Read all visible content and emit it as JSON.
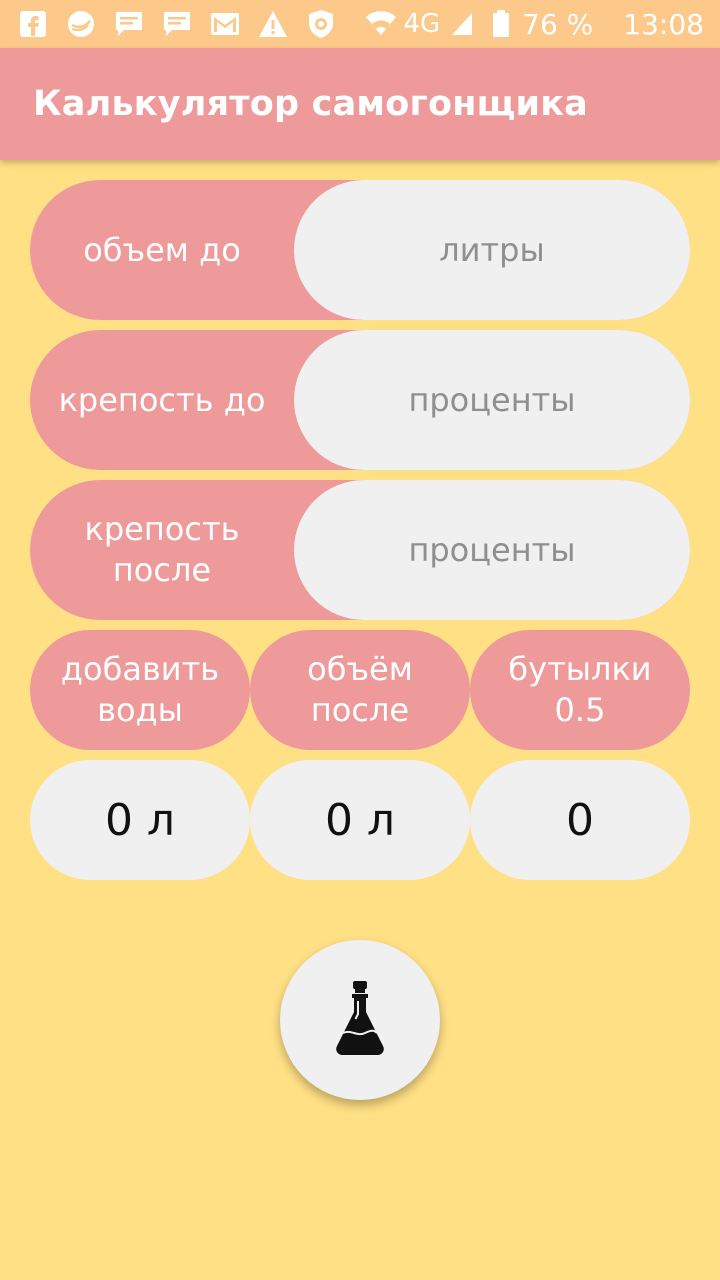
{
  "status_bar": {
    "network": "4G",
    "battery": "76 %",
    "time": "13:08"
  },
  "app_bar": {
    "title": "Калькулятор самогонщика"
  },
  "inputs": [
    {
      "label": "объем до",
      "placeholder": "литры",
      "value": ""
    },
    {
      "label": "крепость до",
      "placeholder": "проценты",
      "value": ""
    },
    {
      "label": "крепость после",
      "placeholder": "проценты",
      "value": ""
    }
  ],
  "results": {
    "headers": [
      "добавить воды",
      "объём после",
      "бутылки 0.5"
    ],
    "values": [
      "0 л",
      "0 л",
      "0"
    ]
  },
  "colors": {
    "background": "#FFE085",
    "status_bar": "#FCC98A",
    "accent": "#EE9A9A",
    "field": "#F0F0F0"
  },
  "icons": {
    "fab": "flask-icon"
  }
}
